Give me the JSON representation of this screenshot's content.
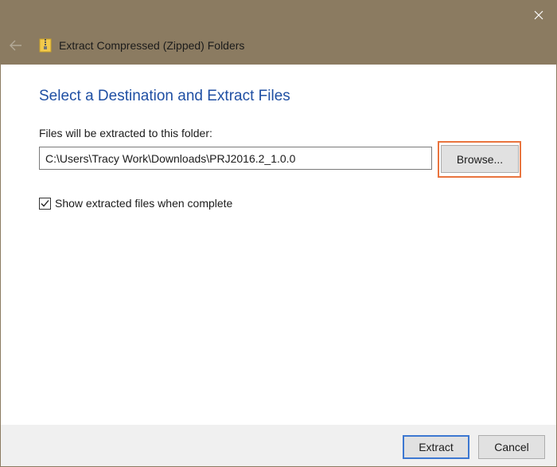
{
  "window": {
    "title": "Extract Compressed (Zipped) Folders",
    "icons": {
      "back": "back-arrow-icon",
      "zip": "zip-folder-icon",
      "close": "close-icon"
    }
  },
  "main": {
    "heading": "Select a Destination and Extract Files",
    "folder_label": "Files will be extracted to this folder:",
    "destination_path": "C:\\Users\\Tracy Work\\Downloads\\PRJ2016.2_1.0.0",
    "browse_label": "Browse...",
    "show_files": {
      "label": "Show extracted files when complete",
      "checked": true
    }
  },
  "footer": {
    "extract_label": "Extract",
    "cancel_label": "Cancel"
  },
  "colors": {
    "titlebar": "#8b7b61",
    "heading": "#1f4fa3",
    "highlight": "#e9743e",
    "default_button_border": "#3d78d1"
  }
}
